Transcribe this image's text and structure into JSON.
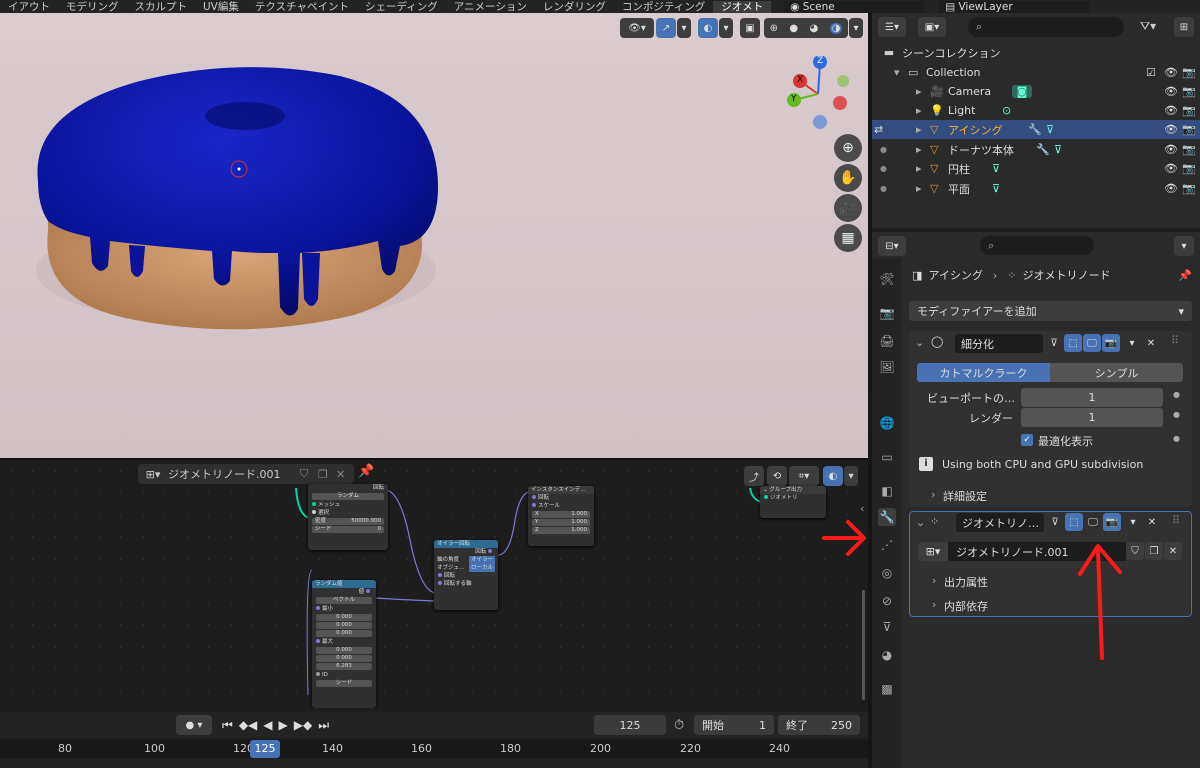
{
  "workspace_tabs": [
    "イアウト",
    "モデリング",
    "スカルプト",
    "UV編集",
    "テクスチャペイント",
    "シェーディング",
    "アニメーション",
    "レンダリング",
    "コンポジティング",
    "ジオメト"
  ],
  "scene_name": "Scene",
  "view_layer": "ViewLayer",
  "gizmo": {
    "z": "Z",
    "x": "X",
    "y": "Y"
  },
  "node_editor": {
    "tree_name": "ジオメトリノード.001",
    "nodes": {
      "distribute": {
        "rot_label": "回転",
        "mode": "ランダム",
        "mesh": "メッシュ",
        "selection": "選択",
        "density_label": "密度",
        "density": "50000.000",
        "seed_label": "シード",
        "seed": "0"
      },
      "instance": {
        "title": "インスタンスインデ…",
        "rot": "回転",
        "scale": "スケール",
        "x": "1.000",
        "y": "1.000",
        "z": "1.000",
        "x_label": "X",
        "y_label": "Y",
        "z_label": "Z"
      },
      "euler": {
        "title": "オイラー回転",
        "rotation": "回転",
        "axis_label": "軸の角度",
        "axis_val": "オイラー",
        "object_label": "オブジェ…",
        "object_val": "ローカル",
        "rot_in": "回転",
        "rot_by": "回転する軸"
      },
      "random": {
        "title": "ランダム値",
        "value": "値",
        "type": "ベクトル",
        "min": "最小",
        "min_vals": [
          "0.000",
          "0.000",
          "0.000"
        ],
        "max": "最大",
        "max_vals": [
          "0.000",
          "0.000",
          "6.283"
        ],
        "id": "ID",
        "seed": "シード"
      },
      "group_out": {
        "title": "グループ出力",
        "geometry": "ジオメトリ"
      }
    }
  },
  "timeline": {
    "current": "125",
    "start_label": "開始",
    "start": "1",
    "end_label": "終了",
    "end": "250",
    "ruler": [
      "80",
      "100",
      "120",
      "140",
      "160",
      "180",
      "200",
      "220",
      "240"
    ],
    "playhead": "125"
  },
  "outliner": {
    "root": "シーンコレクション",
    "collection": "Collection",
    "items": [
      {
        "name": "Camera",
        "selected": false
      },
      {
        "name": "Light",
        "selected": false
      },
      {
        "name": "アイシング",
        "selected": true
      },
      {
        "name": "ドーナツ本体",
        "selected": false
      },
      {
        "name": "円柱",
        "selected": false
      },
      {
        "name": "平面",
        "selected": false
      }
    ]
  },
  "properties": {
    "breadcrumb_object": "アイシング",
    "breadcrumb_modifier": "ジオメトリノード",
    "add_modifier": "モディファイアーを追加",
    "subdiv": {
      "name": "細分化",
      "mode_a": "カトマルクラーク",
      "mode_b": "シンプル",
      "viewport_label": "ビューポートの…",
      "viewport": "1",
      "render_label": "レンダー",
      "render": "1",
      "optimal": "最適化表示",
      "info": "Using both CPU and GPU subdivision",
      "advanced": "詳細設定"
    },
    "geonodes": {
      "name": "ジオメトリノ…",
      "tree": "ジオメトリノード.001",
      "output_attrs": "出力属性",
      "internal": "内部依存"
    }
  },
  "colors": {
    "accent": "#4772b3",
    "selection": "#334d80",
    "icing": "#0a139a",
    "annotation": "#ff1a1a"
  }
}
